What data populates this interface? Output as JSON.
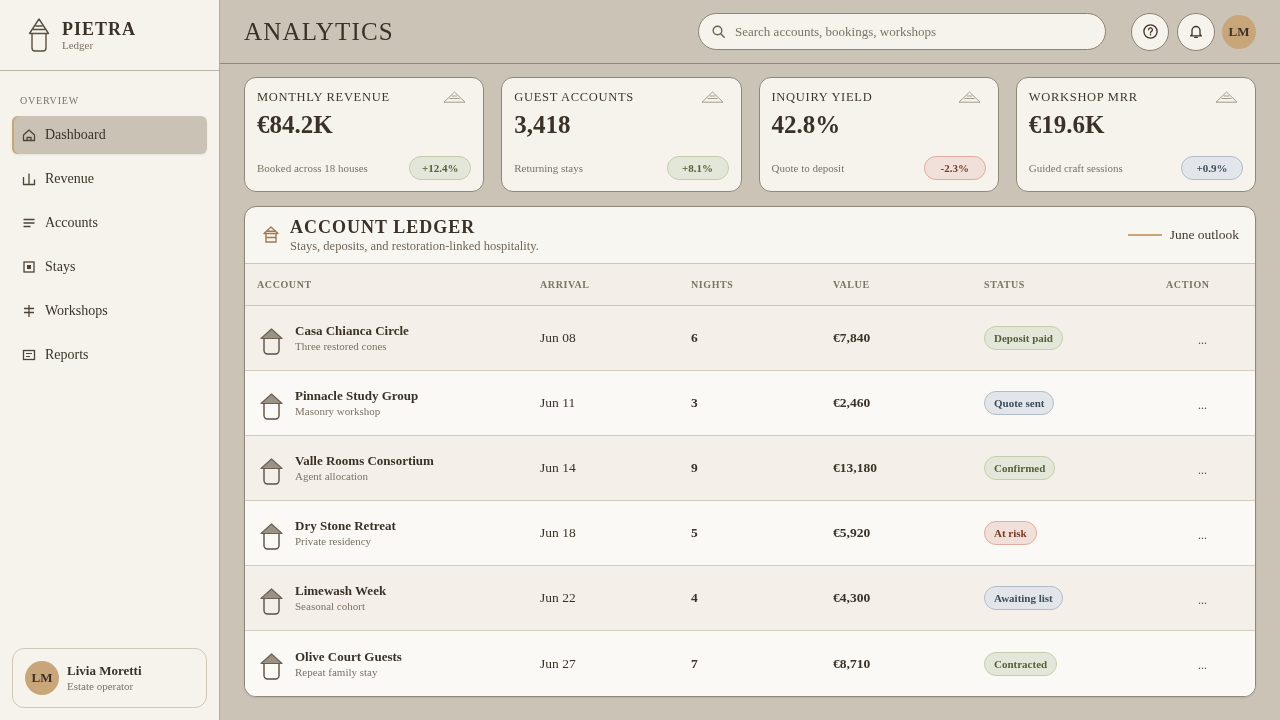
{
  "brand": {
    "name": "PIETRA",
    "subtitle": "Ledger"
  },
  "sidebar": {
    "section": "OVERVIEW",
    "items": [
      {
        "label": "Dashboard",
        "kind": "home",
        "selected": true
      },
      {
        "label": "Revenue",
        "kind": "bars",
        "selected": false
      },
      {
        "label": "Accounts",
        "kind": "list",
        "selected": false
      },
      {
        "label": "Stays",
        "kind": "square",
        "selected": false
      },
      {
        "label": "Workshops",
        "kind": "cross",
        "selected": false
      },
      {
        "label": "Reports",
        "kind": "doc",
        "selected": false
      }
    ]
  },
  "user": {
    "initials": "LM",
    "name": "Livia Moretti",
    "role": "Estate operator"
  },
  "header": {
    "title": "ANALYTICS",
    "search": {
      "placeholder": "Search accounts, bookings, workshops"
    },
    "avatar": "LM"
  },
  "kpis": [
    {
      "label": "MONTHLY REVENUE",
      "value": "€84.2K",
      "note": "Booked across 18 houses",
      "delta": "+12.4%",
      "color": "#e3e7da"
    },
    {
      "label": "GUEST ACCOUNTS",
      "value": "3,418",
      "note": "Returning stays",
      "delta": "+8.1%",
      "color": "#e3e7da"
    },
    {
      "label": "INQUIRY YIELD",
      "value": "42.8%",
      "note": "Quote to deposit",
      "delta": "-2.3%",
      "color": "#f1e0da"
    },
    {
      "label": "WORKSHOP MRR",
      "value": "€19.6K",
      "note": "Guided craft sessions",
      "delta": "+0.9%",
      "color": "#e2e6ea"
    }
  ],
  "ledger": {
    "title": "ACCOUNT LEDGER",
    "subtitle": "Stays, deposits, and restoration-linked hospitality.",
    "legend": "June outlook",
    "columns": [
      "ACCOUNT",
      "ARRIVAL",
      "NIGHTS",
      "VALUE",
      "STATUS",
      "ACTION"
    ],
    "rows": [
      {
        "account": "Casa Chianca Circle",
        "detail": "Three restored cones",
        "arrival": "Jun 08",
        "nights": "6",
        "value": "€7,840",
        "status": "Deposit paid",
        "color": "#e3e7da",
        "action": "..."
      },
      {
        "account": "Pinnacle Study Group",
        "detail": "Masonry workshop",
        "arrival": "Jun 11",
        "nights": "3",
        "value": "€2,460",
        "status": "Quote sent",
        "color": "#e2e6ea",
        "action": "..."
      },
      {
        "account": "Valle Rooms Consortium",
        "detail": "Agent allocation",
        "arrival": "Jun 14",
        "nights": "9",
        "value": "€13,180",
        "status": "Confirmed",
        "color": "#e3e7da",
        "action": "..."
      },
      {
        "account": "Dry Stone Retreat",
        "detail": "Private residency",
        "arrival": "Jun 18",
        "nights": "5",
        "value": "€5,920",
        "status": "At risk",
        "color": "#f1e0da",
        "action": "..."
      },
      {
        "account": "Limewash Week",
        "detail": "Seasonal cohort",
        "arrival": "Jun 22",
        "nights": "4",
        "value": "€4,300",
        "status": "Awaiting list",
        "color": "#e2e6ea",
        "action": "..."
      },
      {
        "account": "Olive Court Guests",
        "detail": "Repeat family stay",
        "arrival": "Jun 27",
        "nights": "7",
        "value": "€8,710",
        "status": "Contracted",
        "color": "#e3e7da",
        "action": "..."
      }
    ]
  }
}
